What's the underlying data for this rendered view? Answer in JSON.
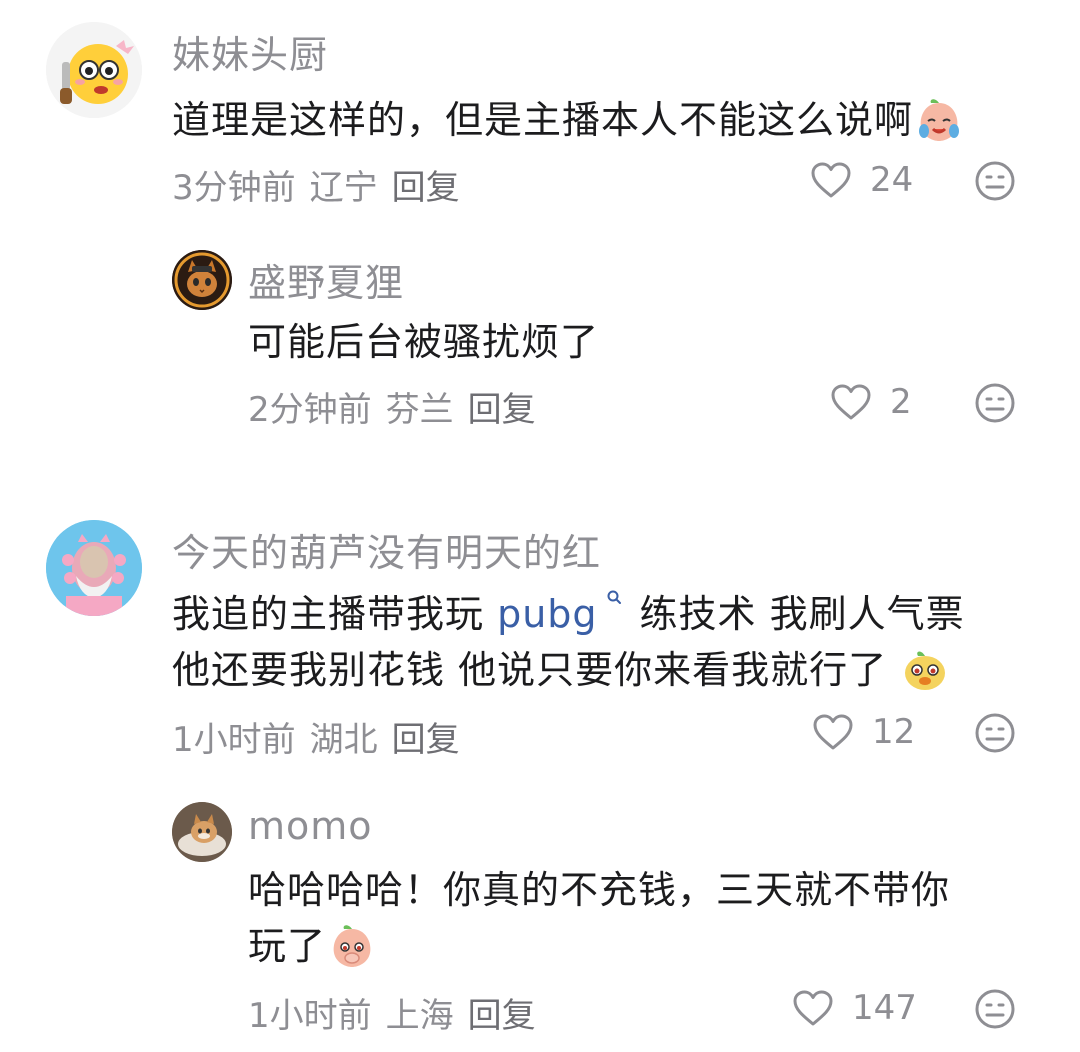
{
  "comments": [
    {
      "username": "妹妹头厨",
      "text": "道理是这样的，但是主播本人不能这么说啊",
      "time": "3分钟前",
      "location": "辽宁",
      "reply_label": "回复",
      "likes": "24",
      "replies": [
        {
          "username": "盛野夏狸",
          "text": "可能后台被骚扰烦了",
          "time": "2分钟前",
          "location": "芬兰",
          "reply_label": "回复",
          "likes": "2"
        }
      ]
    },
    {
      "username": "今天的葫芦没有明天的红",
      "text_line1_before": "我追的主播带我玩 ",
      "text_line1_link": "pubg",
      "text_line1_after": "练技术 我刷人气票",
      "text_line2": "他还要我别花钱 他说只要你来看我就行了",
      "time": "1小时前",
      "location": "湖北",
      "reply_label": "回复",
      "likes": "12",
      "replies": [
        {
          "username": "momo",
          "text_line1": "哈哈哈哈！你真的不充钱，三天就不带你",
          "text_line2": "玩了",
          "time": "1小时前",
          "location": "上海",
          "reply_label": "回复",
          "likes": "147"
        }
      ]
    }
  ],
  "icons": {
    "like": "heart-outline-icon",
    "dislike": "unhappy-face-icon",
    "search": "search-icon"
  },
  "colors": {
    "meta": "#8e8e93",
    "link": "#3a5fa6",
    "text": "#1c1c1e"
  }
}
